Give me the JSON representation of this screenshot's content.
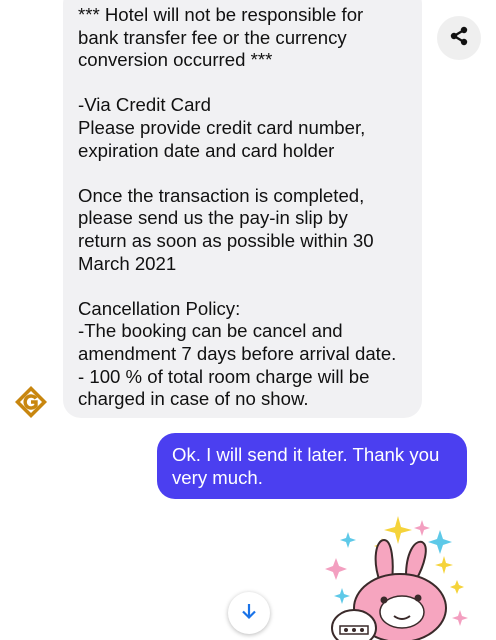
{
  "incoming_message": {
    "paragraphs": [
      "*** Hotel will not be responsible for\nbank transfer fee or the currency\nconversion occurred ***",
      "-Via Credit Card\nPlease provide credit card number,\nexpiration date and card holder",
      "Once the transaction is completed,\nplease send us the pay-in slip by\nreturn as soon as possible within 30\nMarch 2021",
      "Cancellation Policy:\n-The booking can be cancel and\namendment 7 days before arrival date.\n- 100 % of total room charge will be\ncharged in case of no show."
    ]
  },
  "outgoing_message": {
    "text": "Ok.  I will send it later.  Thank you\nvery much."
  },
  "icons": {
    "avatar": "hotel-logo-icon",
    "share": "share-icon",
    "scroll": "arrow-down-icon",
    "sticker": "bunny-sticker"
  },
  "colors": {
    "incoming_bubble": "#f1f1f3",
    "outgoing_bubble": "#4b3ff0",
    "accent": "#1a73e8",
    "logo": "#c8860f"
  }
}
